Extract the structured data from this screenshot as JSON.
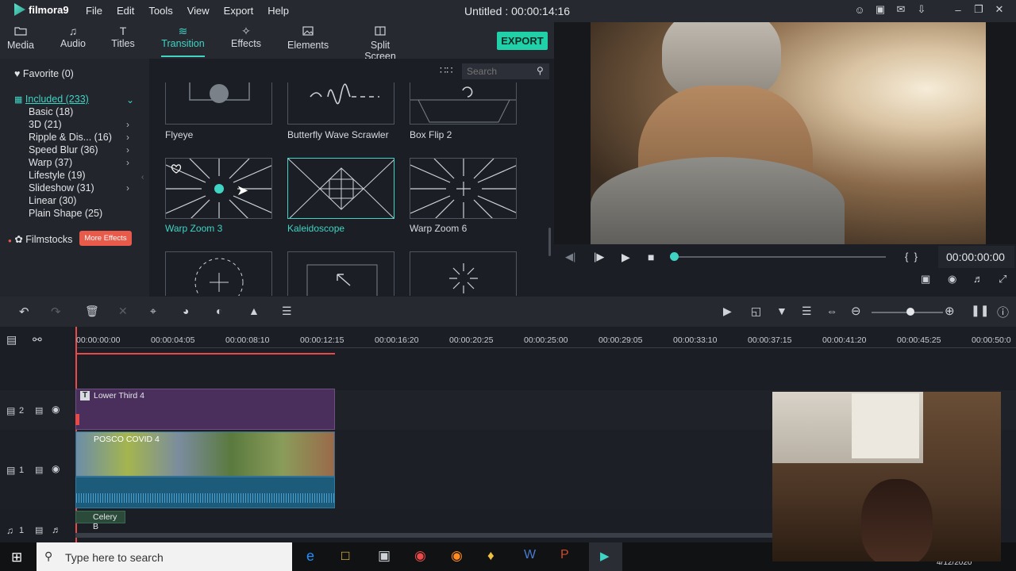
{
  "app": {
    "name": "filmora9",
    "title": "Untitled : 00:00:14:16"
  },
  "menu": [
    "File",
    "Edit",
    "Tools",
    "View",
    "Export",
    "Help"
  ],
  "tabs": [
    {
      "label": "Media",
      "icon": "folder-icon"
    },
    {
      "label": "Audio",
      "icon": "music-note-icon"
    },
    {
      "label": "Titles",
      "icon": "text-t-icon"
    },
    {
      "label": "Transition",
      "icon": "transition-icon"
    },
    {
      "label": "Effects",
      "icon": "effects-icon"
    },
    {
      "label": "Elements",
      "icon": "image-icon"
    },
    {
      "label": "Split Screen",
      "icon": "split-screen-icon"
    }
  ],
  "export_label": "EXPORT",
  "categories": {
    "favorite": "Favorite (0)",
    "included": "Included (233)",
    "items": [
      "Basic (18)",
      "3D (21)",
      "Ripple & Dis... (16)",
      "Speed Blur (36)",
      "Warp (37)",
      "Lifestyle (19)",
      "Slideshow (31)",
      "Linear (30)",
      "Plain Shape (25)"
    ],
    "filmstocks": "Filmstocks",
    "more_effects": "More Effects"
  },
  "search": {
    "placeholder": "Search"
  },
  "transitions": [
    "Flyeye",
    "Butterfly Wave Scrawler",
    "Box Flip 2",
    "Warp Zoom 3",
    "Kaleidoscope",
    "Warp Zoom 6"
  ],
  "preview": {
    "timecode": "00:00:00:00"
  },
  "timeline": {
    "ticks": [
      "00:00:00:00",
      "00:00:04:05",
      "00:00:08:10",
      "00:00:12:15",
      "00:00:16:20",
      "00:00:20:25",
      "00:00:25:00",
      "00:00:29:05",
      "00:00:33:10",
      "00:00:37:15",
      "00:00:41:20",
      "00:00:45:25",
      "00:00:50:0"
    ],
    "track2_num": "2",
    "track1_num": "1",
    "audio_num": "1",
    "title_clip": "Lower Third 4",
    "video_clip": "POSCO COVID 4",
    "audio_clip": "Celery B"
  },
  "taskbar": {
    "search_placeholder": "Type here to search",
    "date": "4/12/2020"
  },
  "colors": {
    "accent": "#3fd4c4",
    "export": "#1fd0a8",
    "title_clip": "#4a2f5c",
    "audio_clip": "#1d5b7a",
    "more_effects": "#e85a4a"
  }
}
